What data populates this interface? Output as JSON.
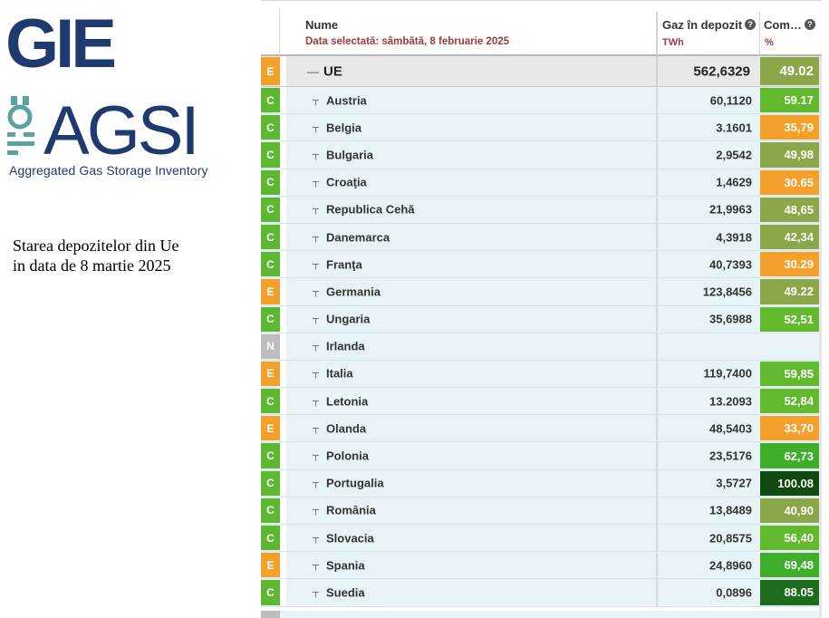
{
  "branding": {
    "gie_logo_text": "GIE",
    "agsi_logo_text": "AGSI",
    "agsi_caption": "Aggregated Gas Storage Inventory",
    "brand_color": "#1f3a6e",
    "accent_color": "#5ba3a3"
  },
  "note": "Starea depozitelor din Ue in data de 8 martie 2025",
  "table": {
    "header": {
      "name_label": "Nume",
      "date_label": "Data selectată: sâmbătă, 8 februarie 2025",
      "gas_label": "Gaz în depozit",
      "gas_unit": "TWh",
      "full_label": "Com…",
      "full_unit": "%",
      "help_icon": "question-circle-icon"
    },
    "total": {
      "flag": "E",
      "name": "UE",
      "gas": "562,6329",
      "full": "49.02",
      "full_color": "#8aa84a",
      "tree_icon": "collapse-icon"
    },
    "rows": [
      {
        "flag": "C",
        "name": "Austria",
        "gas": "60,1120",
        "full": "59.17",
        "full_color": "#62b92e"
      },
      {
        "flag": "C",
        "name": "Belgia",
        "gas": "3.1601",
        "full": "35,79",
        "full_color": "#f5a02a"
      },
      {
        "flag": "C",
        "name": "Bulgaria",
        "gas": "2,9542",
        "full": "49,98",
        "full_color": "#8aa84a"
      },
      {
        "flag": "C",
        "name": "Croaţia",
        "gas": "1,4629",
        "full": "30.65",
        "full_color": "#f5a02a"
      },
      {
        "flag": "C",
        "name": "Republica Cehă",
        "gas": "21,9963",
        "full": "48,65",
        "full_color": "#8aa84a"
      },
      {
        "flag": "C",
        "name": "Danemarca",
        "gas": "4,3918",
        "full": "42,34",
        "full_color": "#8aa84a"
      },
      {
        "flag": "C",
        "name": "Franţa",
        "gas": "40,7393",
        "full": "30.29",
        "full_color": "#f5a02a"
      },
      {
        "flag": "E",
        "name": "Germania",
        "gas": "123,8456",
        "full": "49.22",
        "full_color": "#8aa84a"
      },
      {
        "flag": "C",
        "name": "Ungaria",
        "gas": "35,6988",
        "full": "52,51",
        "full_color": "#62b92e"
      },
      {
        "flag": "N",
        "name": "Irlanda",
        "gas": "",
        "full": "",
        "full_color": ""
      },
      {
        "flag": "E",
        "name": "Italia",
        "gas": "119,7400",
        "full": "59,85",
        "full_color": "#62b92e"
      },
      {
        "flag": "C",
        "name": "Letonia",
        "gas": "13.2093",
        "full": "52,84",
        "full_color": "#62b92e"
      },
      {
        "flag": "E",
        "name": "Olanda",
        "gas": "48,5403",
        "full": "33,70",
        "full_color": "#f5a02a"
      },
      {
        "flag": "C",
        "name": "Polonia",
        "gas": "23,5176",
        "full": "62,73",
        "full_color": "#3fae2a"
      },
      {
        "flag": "C",
        "name": "Portugalia",
        "gas": "3,5727",
        "full": "100.08",
        "full_color": "#0f4a0f"
      },
      {
        "flag": "C",
        "name": "România",
        "gas": "13,8489",
        "full": "40,90",
        "full_color": "#8aa84a"
      },
      {
        "flag": "C",
        "name": "Slovacia",
        "gas": "20,8575",
        "full": "56,40",
        "full_color": "#62b92e"
      },
      {
        "flag": "E",
        "name": "Spania",
        "gas": "24,8960",
        "full": "69,48",
        "full_color": "#3fae2a"
      },
      {
        "flag": "C",
        "name": "Suedia",
        "gas": "0,0896",
        "full": "88.05",
        "full_color": "#1d6b1d"
      }
    ],
    "flag_colors": {
      "C": "#5cb82e",
      "E": "#f5a02a",
      "N": "#bdbdbd"
    },
    "row_tree_icon": "tree-branch-icon"
  }
}
